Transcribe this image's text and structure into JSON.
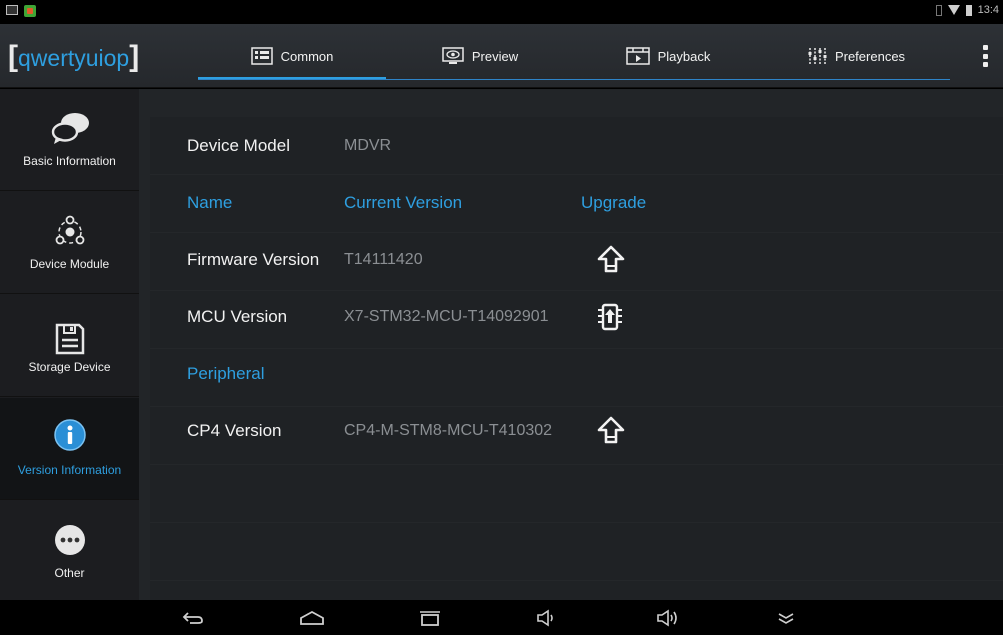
{
  "status_bar": {
    "time": "13:4"
  },
  "header": {
    "brand": "qwertyuiop",
    "tabs": [
      {
        "label": "Common",
        "icon": "common-icon",
        "active": true
      },
      {
        "label": "Preview",
        "icon": "preview-icon",
        "active": false
      },
      {
        "label": "Playback",
        "icon": "playback-icon",
        "active": false
      },
      {
        "label": "Preferences",
        "icon": "preferences-icon",
        "active": false
      }
    ]
  },
  "sidebar": {
    "items": [
      {
        "label": "Basic Information",
        "icon": "chat-bubbles-icon"
      },
      {
        "label": "Device Module",
        "icon": "device-module-icon"
      },
      {
        "label": "Storage Device",
        "icon": "floppy-disk-icon"
      },
      {
        "label": "Version Information",
        "icon": "info-icon",
        "active": true
      },
      {
        "label": "Other",
        "icon": "more-icon"
      }
    ]
  },
  "content": {
    "device_model_label": "Device Model",
    "device_model_value": "MDVR",
    "header": {
      "name": "Name",
      "current_version": "Current Version",
      "upgrade": "Upgrade"
    },
    "rows": [
      {
        "name": "Firmware Version",
        "version": "T14111420",
        "action_icon": "upgrade-arrow-icon"
      },
      {
        "name": "MCU Version",
        "version": "X7-STM32-MCU-T14092901",
        "action_icon": "chip-upgrade-icon"
      }
    ],
    "peripheral_label": "Peripheral",
    "peripheral_rows": [
      {
        "name": "CP4 Version",
        "version": "CP4-M-STM8-MCU-T410302",
        "action_icon": "upgrade-arrow-icon"
      }
    ]
  },
  "nav_bar": {
    "buttons": [
      "back-icon",
      "home-icon",
      "recent-apps-icon",
      "volume-down-icon",
      "volume-up-icon",
      "hide-keyboard-icon"
    ]
  },
  "colors": {
    "accent": "#2e9fe0",
    "background": "#222528",
    "sidebar": "#1c1d20",
    "muted_text": "#8b8f93"
  }
}
